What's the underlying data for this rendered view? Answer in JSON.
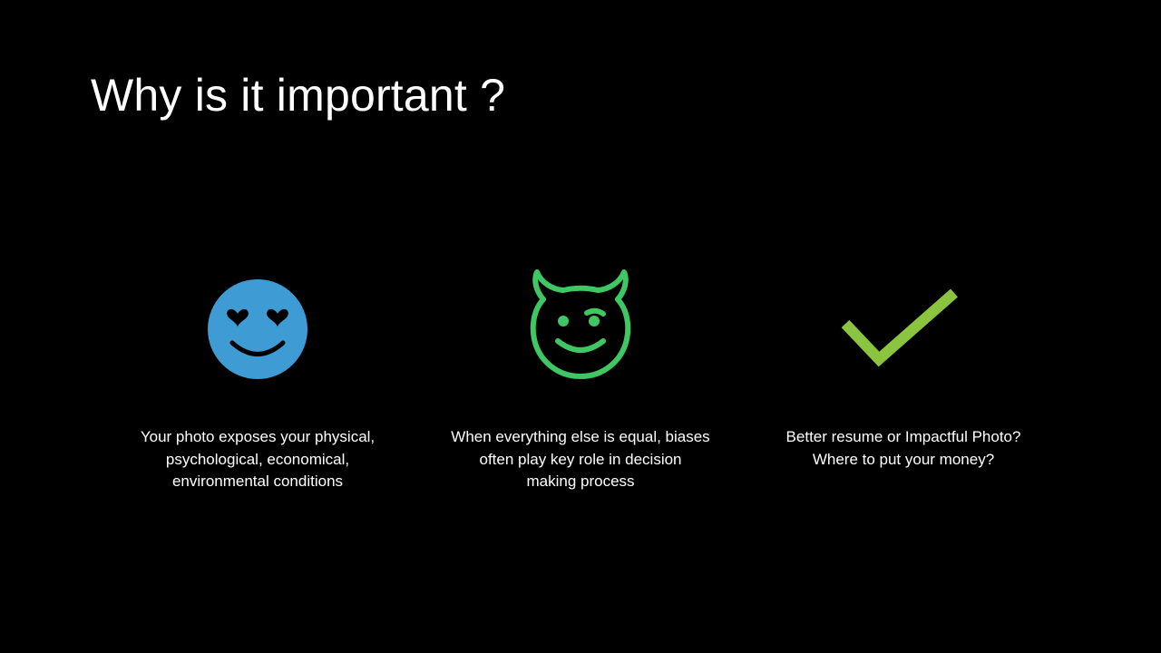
{
  "slide": {
    "title": "Why is it important ?",
    "background": "#000000"
  },
  "columns": [
    {
      "icon": "smiling-face-with-heart-eyes-icon",
      "icon_color": "#3f9bd4",
      "lines": [
        "Your photo exposes your physical,",
        "psychological, economical,",
        "environmental conditions"
      ]
    },
    {
      "icon": "smiling-devil-face-icon",
      "icon_color": "#3ec763",
      "lines": [
        "When everything else is equal, biases",
        "often play key role in decision",
        "making process"
      ]
    },
    {
      "icon": "checkmark-icon",
      "icon_color": "#8bc53f",
      "lines": [
        "Better resume or Impactful Photo?",
        "Where to put your money?"
      ]
    }
  ]
}
